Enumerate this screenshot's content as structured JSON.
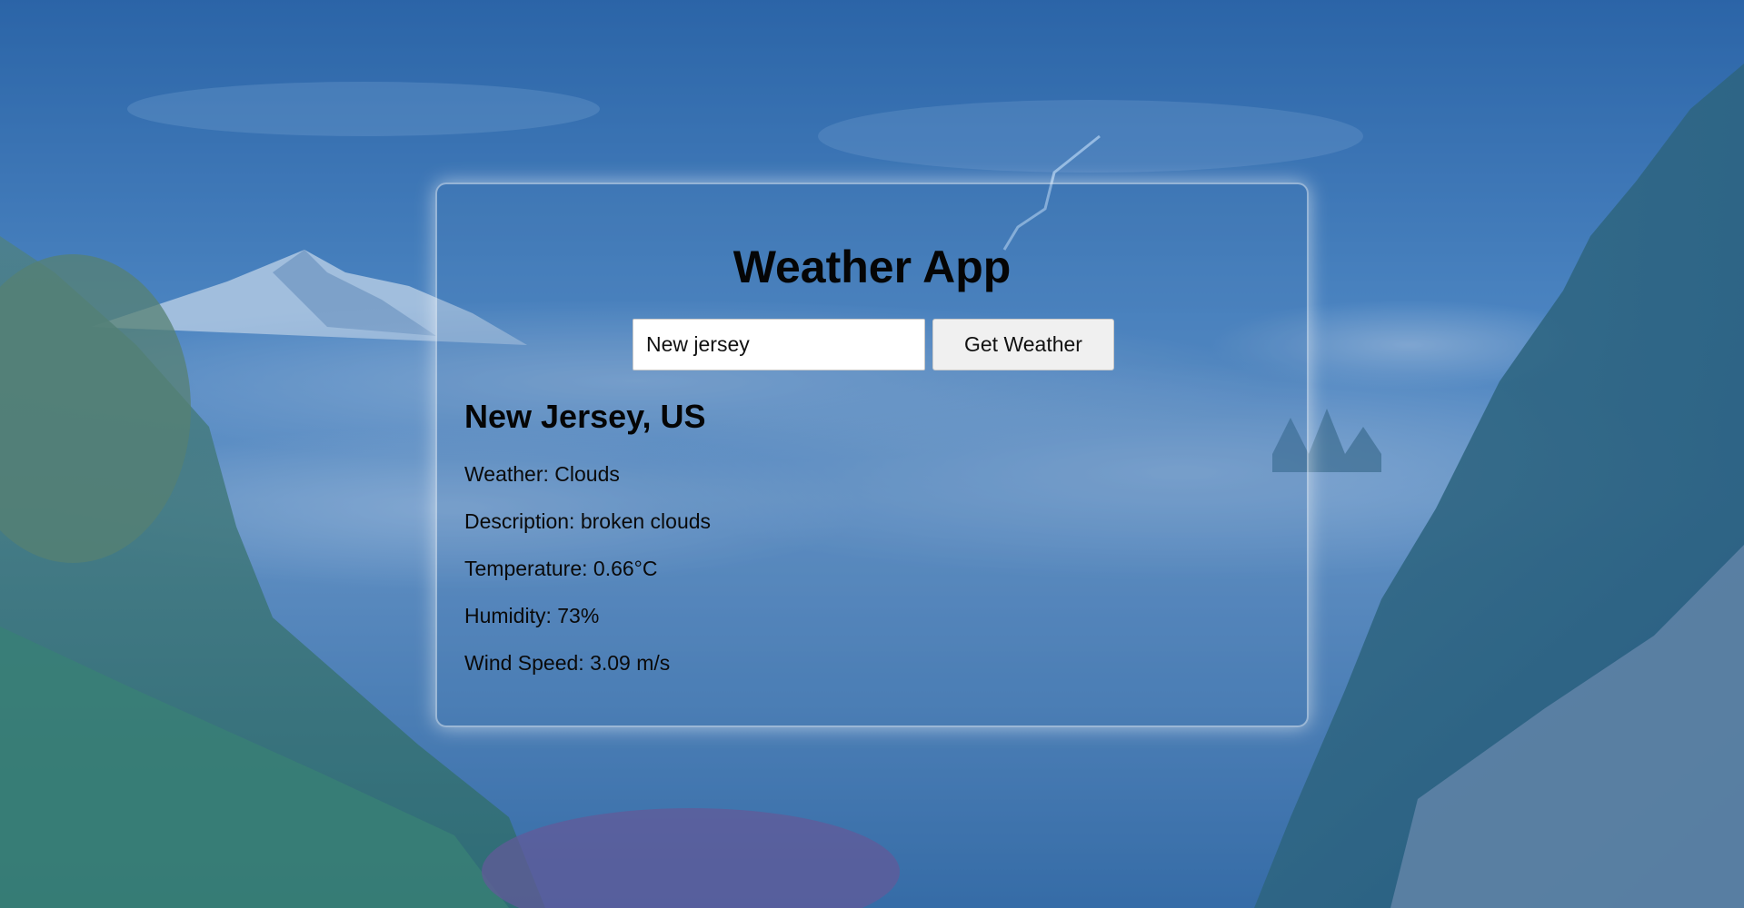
{
  "app": {
    "title": "Weather App"
  },
  "search": {
    "value": "New jersey",
    "button_label": "Get Weather"
  },
  "result": {
    "location": "New Jersey, US",
    "weather": "Weather: Clouds",
    "description": "Description: broken clouds",
    "temperature": "Temperature: 0.66°C",
    "humidity": "Humidity: 73%",
    "wind_speed": "Wind Speed: 3.09 m/s"
  },
  "colors": {
    "sky": "#2c64a6",
    "card_border": "#ffffff",
    "text": "#050505",
    "button_bg": "#f0f0f0"
  }
}
